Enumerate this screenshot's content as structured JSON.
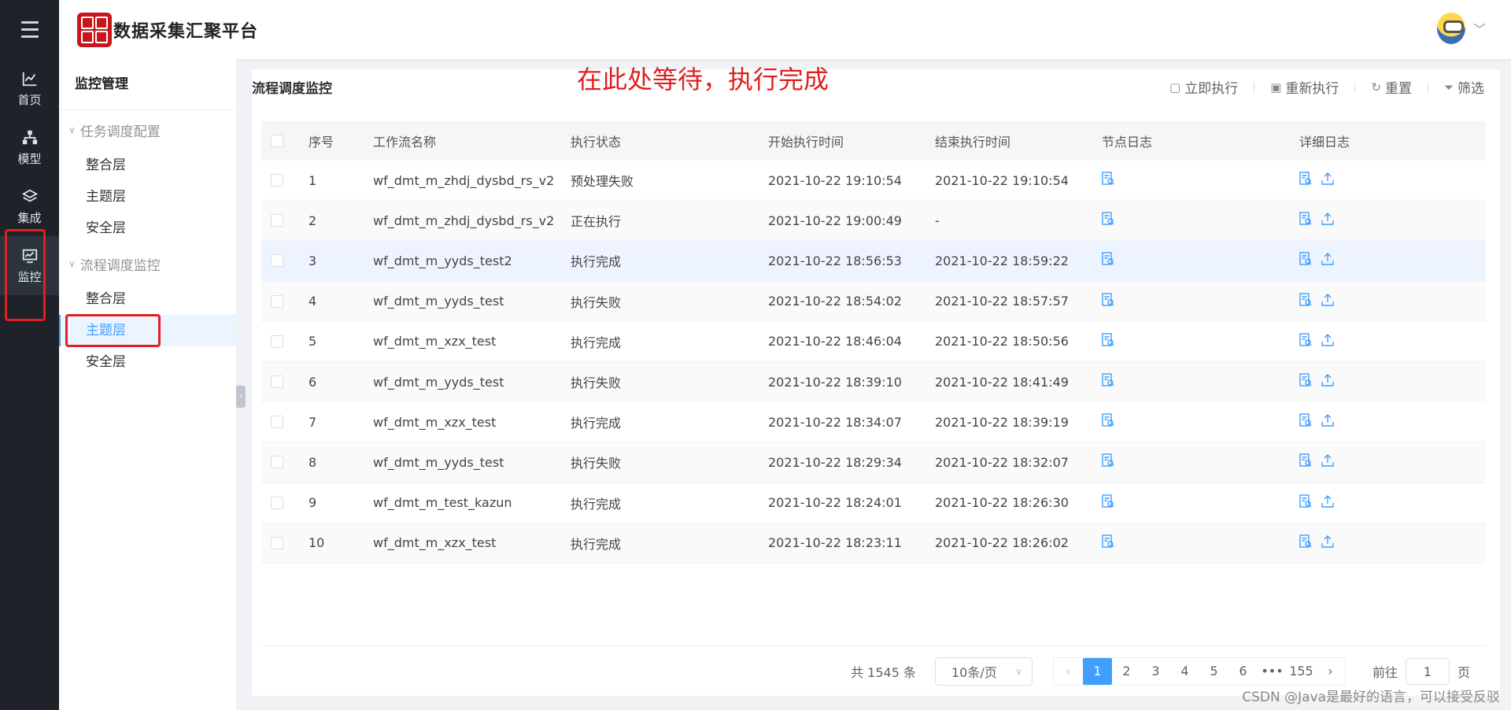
{
  "app": {
    "title": "数据采集汇聚平台"
  },
  "rail": {
    "items": [
      {
        "label": "首页",
        "icon": "chart-line-icon"
      },
      {
        "label": "模型",
        "icon": "sitemap-icon"
      },
      {
        "label": "集成",
        "icon": "layers-icon"
      },
      {
        "label": "监控",
        "icon": "monitor-icon"
      }
    ]
  },
  "subnav": {
    "title": "监控管理",
    "groups": [
      {
        "label": "任务调度配置",
        "items": [
          "整合层",
          "主题层",
          "安全层"
        ]
      },
      {
        "label": "流程调度监控",
        "items": [
          "整合层",
          "主题层",
          "安全层"
        ]
      }
    ]
  },
  "main": {
    "title": "流程调度监控",
    "annotation": "在此处等待，执行完成",
    "tools": [
      "立即执行",
      "重新执行",
      "重置",
      "筛选"
    ]
  },
  "table": {
    "headers": [
      "序号",
      "工作流名称",
      "执行状态",
      "开始执行时间",
      "结束执行时间",
      "节点日志",
      "详细日志"
    ],
    "rows": [
      [
        "1",
        "wf_dmt_m_zhdj_dysbd_rs_v2",
        "预处理失败",
        "2021-10-22 19:10:54",
        "2021-10-22 19:10:54"
      ],
      [
        "2",
        "wf_dmt_m_zhdj_dysbd_rs_v2",
        "正在执行",
        "2021-10-22 19:00:49",
        "-"
      ],
      [
        "3",
        "wf_dmt_m_yyds_test2",
        "执行完成",
        "2021-10-22 18:56:53",
        "2021-10-22 18:59:22"
      ],
      [
        "4",
        "wf_dmt_m_yyds_test",
        "执行失败",
        "2021-10-22 18:54:02",
        "2021-10-22 18:57:57"
      ],
      [
        "5",
        "wf_dmt_m_xzx_test",
        "执行完成",
        "2021-10-22 18:46:04",
        "2021-10-22 18:50:56"
      ],
      [
        "6",
        "wf_dmt_m_yyds_test",
        "执行失败",
        "2021-10-22 18:39:10",
        "2021-10-22 18:41:49"
      ],
      [
        "7",
        "wf_dmt_m_xzx_test",
        "执行完成",
        "2021-10-22 18:34:07",
        "2021-10-22 18:39:19"
      ],
      [
        "8",
        "wf_dmt_m_yyds_test",
        "执行失败",
        "2021-10-22 18:29:34",
        "2021-10-22 18:32:07"
      ],
      [
        "9",
        "wf_dmt_m_test_kazun",
        "执行完成",
        "2021-10-22 18:24:01",
        "2021-10-22 18:26:30"
      ],
      [
        "10",
        "wf_dmt_m_xzx_test",
        "执行完成",
        "2021-10-22 18:23:11",
        "2021-10-22 18:26:02"
      ]
    ]
  },
  "pagination": {
    "total": "共 1545 条",
    "page_size": "10条/页",
    "pages": [
      "1",
      "2",
      "3",
      "4",
      "5",
      "6",
      "•••",
      "155"
    ],
    "goto_label": "前往",
    "goto_value": "1",
    "goto_suffix": "页"
  },
  "watermark": "CSDN @Java是最好的语言，可以接受反驳",
  "colors": {
    "accent": "#409eff",
    "annotation": "#e02020",
    "rail": "#1f2329"
  }
}
